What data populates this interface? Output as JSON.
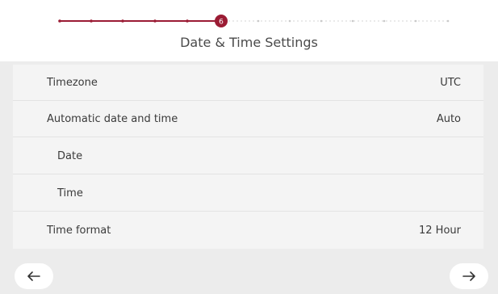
{
  "stepper": {
    "current_step": "6",
    "total_steps": 13,
    "completed_color": "#9b1c34",
    "pending_color": "#c9c9c9"
  },
  "header": {
    "title": "Date & Time Settings"
  },
  "settings": [
    {
      "label": "Timezone",
      "value": "UTC"
    },
    {
      "label": "Automatic date and time",
      "value": "Auto"
    },
    {
      "label": "Date",
      "value": ""
    },
    {
      "label": "Time",
      "value": ""
    },
    {
      "label": "Time format",
      "value": "12 Hour"
    }
  ],
  "footer": {
    "back_icon": "arrow-left-icon",
    "next_icon": "arrow-right-icon"
  }
}
